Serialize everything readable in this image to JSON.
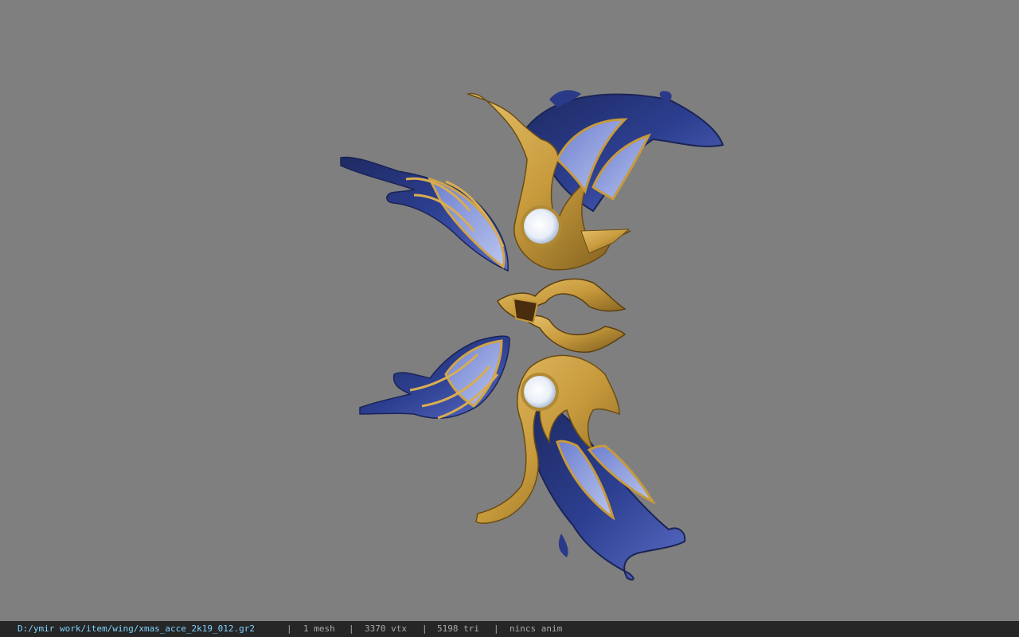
{
  "viewer": {
    "background_color": "#7f7f7f",
    "model_colors": {
      "gold": "#c79a3c",
      "gold_dark": "#7a5a1c",
      "blue": "#2c3e8f",
      "blue_light": "#a9b7e6",
      "blue_dark": "#1e2a62",
      "orb": "#e8eef7"
    }
  },
  "statusbar": {
    "file_path": "D:/ymir work/item/wing/xmas_acce_2k19_012.gr2",
    "separator": "|",
    "mesh_count": "1 mesh",
    "vertex_count": "3370 vtx",
    "triangle_count": "5198 tri",
    "anim_info": "nincs anim",
    "path_color": "#7fd3ff",
    "text_color": "#a9a9a9"
  }
}
